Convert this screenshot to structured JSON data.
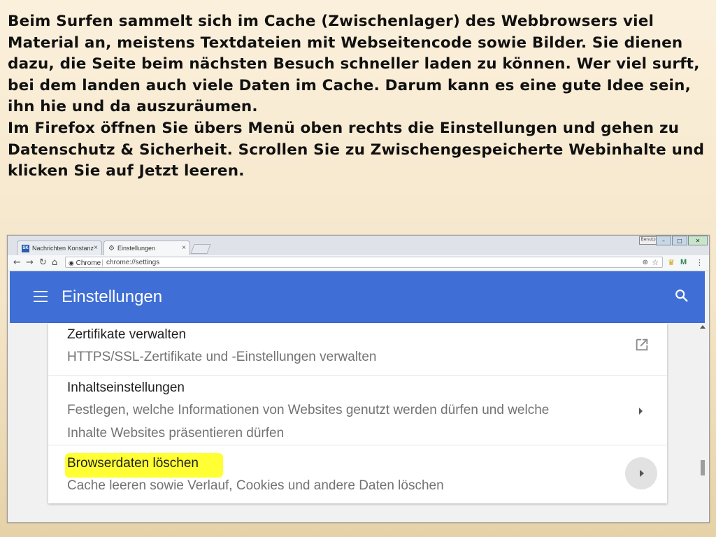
{
  "intro": {
    "paragraph1": "Beim Surfen sammelt sich im Cache (Zwischenlager) des Webbrowsers viel Material an, meistens Textdateien mit Webseitencode sowie Bilder. Sie dienen dazu, die Seite beim nächsten Besuch schneller laden zu können. Wer viel surft, bei dem landen auch viele Daten im Cache. Darum kann es eine gute Idee sein, ihn hie und da auszuräumen.",
    "paragraph2": "Im Firefox öffnen Sie übers Menü oben rechts die Einstellungen und gehen zu Datenschutz & Sicherheit. Scrollen Sie zu Zwischengespeicherte Webinhalte und klicken Sie auf Jetzt leeren."
  },
  "browser": {
    "tabs": [
      {
        "label": "Nachrichten Konstanz | S",
        "favicon": "SK"
      },
      {
        "label": "Einstellungen",
        "favicon": "gear"
      }
    ],
    "tab_close_glyph": "×",
    "user_button": "Benutzer",
    "omnibox": {
      "secure_label": "Chrome",
      "url": "chrome://settings"
    }
  },
  "settings": {
    "app_title": "Einstellungen",
    "items": [
      {
        "title": "Zertifikate verwalten",
        "subtitle": "HTTPS/SSL-Zertifikate und -Einstellungen verwalten",
        "action_icon": "open-in-new-icon"
      },
      {
        "title": "Inhaltseinstellungen",
        "subtitle_line1": "Festlegen, welche Informationen von Websites genutzt werden dürfen und welche",
        "subtitle_line2": "Inhalte Websites präsentieren dürfen",
        "action_icon": "chevron-right-icon"
      },
      {
        "title": "Browserdaten löschen",
        "subtitle": "Cache leeren sowie Verlauf, Cookies und andere Daten löschen",
        "action_icon": "chevron-right-icon",
        "highlight_color": "#ffff33"
      }
    ]
  },
  "colors": {
    "appbar": "#3e6ed6",
    "highlight": "#ffff33"
  }
}
